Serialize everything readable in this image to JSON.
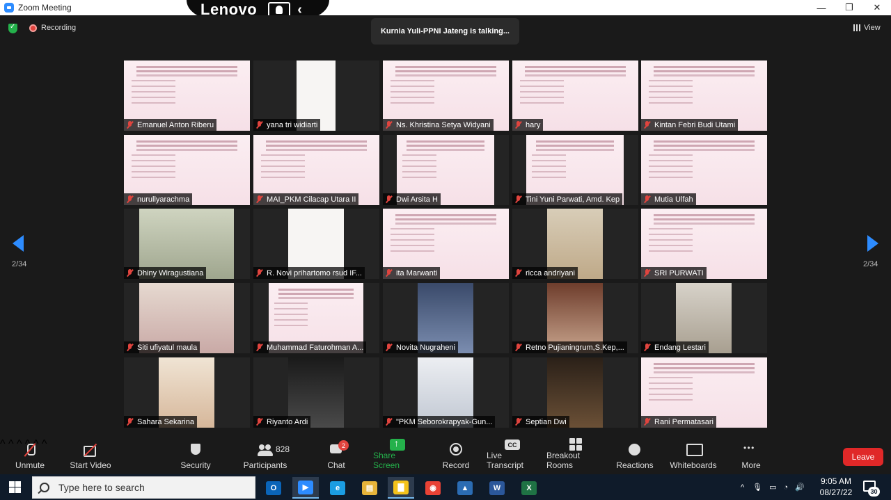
{
  "window": {
    "title": "Zoom Meeting",
    "controls": {
      "minimize": "—",
      "maximize": "❐",
      "close": "✕"
    },
    "overlay_brand": "Lenovo"
  },
  "meeting": {
    "recording_label": "Recording",
    "talking_banner": "Kurnia Yuli-PPNI Jateng is talking...",
    "view_label": "View",
    "page_left": "2/34",
    "page_right": "2/34",
    "participants": [
      {
        "name": "Emanuel Anton Riberu",
        "video": "slide"
      },
      {
        "name": "yana tri widiarti",
        "video": "slide"
      },
      {
        "name": "Ns. Khristina Setya Widyani",
        "video": "slide"
      },
      {
        "name": "hary",
        "video": "slide"
      },
      {
        "name": "Kintan Febri Budi Utami",
        "video": "slide"
      },
      {
        "name": "nurullyarachma",
        "video": "slide"
      },
      {
        "name": "MAI_PKM Cilacap Utara II",
        "video": "slide"
      },
      {
        "name": "Dwi Arsita H",
        "video": "slide"
      },
      {
        "name": "Tini Yuni Parwati, Amd. Kep",
        "video": "slide"
      },
      {
        "name": "Mutia Ulfah",
        "video": "slide"
      },
      {
        "name": "Dhiny Wiragustiana",
        "video": "camera"
      },
      {
        "name": "R. Novi prihartomo rsud IF...",
        "video": "slide"
      },
      {
        "name": "ita Marwanti",
        "video": "slide"
      },
      {
        "name": "ricca andriyani",
        "video": "camera"
      },
      {
        "name": "SRI PURWATI",
        "video": "slide"
      },
      {
        "name": "Siti ufiyatul maula",
        "video": "camera"
      },
      {
        "name": "Muhammad Faturohman A...",
        "video": "slide"
      },
      {
        "name": "Novita Nugraheni",
        "video": "camera"
      },
      {
        "name": "Retno Pujianingrum,S.Kep,...",
        "video": "camera"
      },
      {
        "name": "Endang Lestari",
        "video": "camera"
      },
      {
        "name": "Sahara Sekarina",
        "video": "camera"
      },
      {
        "name": "Riyanto Ardi",
        "video": "camera"
      },
      {
        "name": "\"PKM Seborokrapyak-Gun...",
        "video": "camera"
      },
      {
        "name": "Septian Dwi",
        "video": "camera"
      },
      {
        "name": "Rani Permatasari",
        "video": "slide"
      }
    ]
  },
  "toolbar": {
    "unmute": "Unmute",
    "start_video": "Start Video",
    "security": "Security",
    "participants": "Participants",
    "participant_count": "828",
    "chat": "Chat",
    "chat_badge": "2",
    "share_screen": "Share Screen",
    "record": "Record",
    "live_transcript": "Live Transcript",
    "breakout_rooms": "Breakout Rooms",
    "reactions": "Reactions",
    "whiteboards": "Whiteboards",
    "more": "More",
    "leave": "Leave",
    "share_color": "#24b14b",
    "leave_color": "#e02828"
  },
  "taskbar": {
    "search_placeholder": "Type here to search",
    "apps": [
      "outlook-icon",
      "zoom-icon",
      "edge-icon",
      "file-explorer-icon",
      "sticky-notes-icon",
      "chrome-icon",
      "photos-icon",
      "word-icon",
      "excel-icon"
    ],
    "time": "9:05 AM",
    "date": "08/27/22",
    "notification_count": "30"
  }
}
